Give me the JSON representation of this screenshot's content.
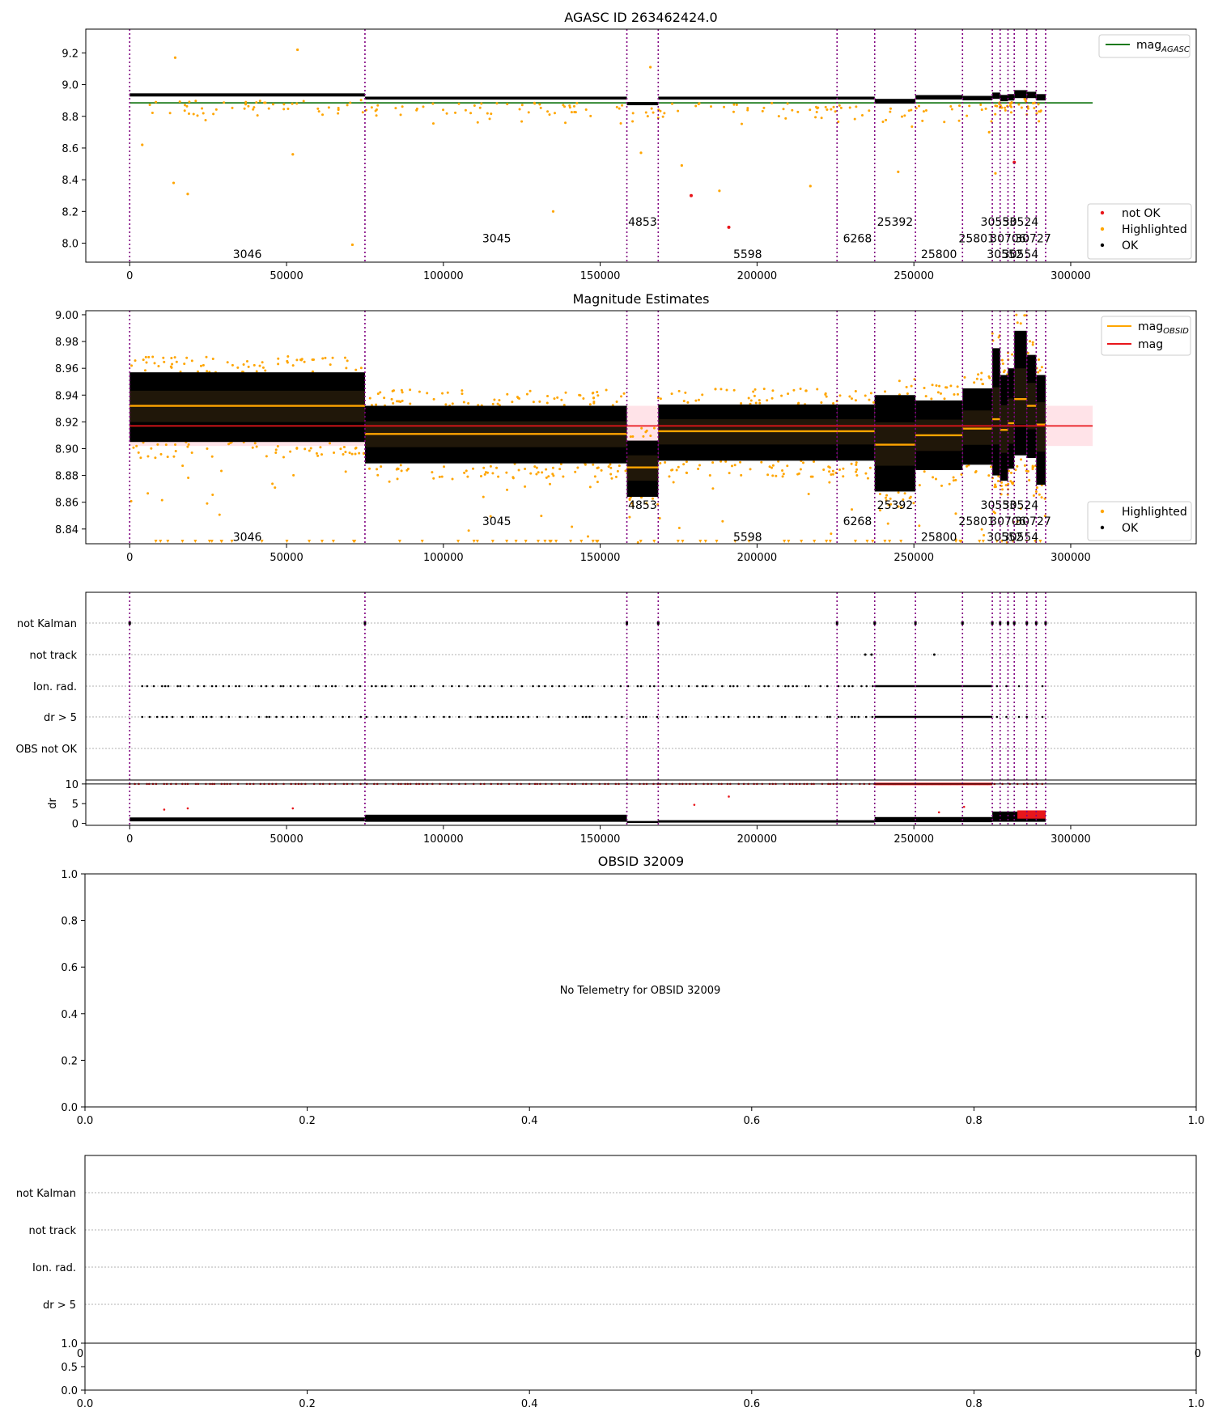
{
  "colors": {
    "agasc_line": "#1a7a1a",
    "mag_line": "#e8161b",
    "mag_band": "#ffc0cb",
    "obsid_line": "#ffa500",
    "highlighted": "#ffa500",
    "not_ok": "#e8161b",
    "ok": "#000000",
    "obs_boundary": "#800080"
  },
  "chart_data": [
    {
      "id": "agasc-panel",
      "type": "scatter",
      "title": "AGASC ID 263462424.0",
      "xlim": [
        -14000,
        340000
      ],
      "ylim": [
        7.88,
        9.35
      ],
      "xticks": [
        "0",
        "50000",
        "100000",
        "150000",
        "200000",
        "250000",
        "300000"
      ],
      "xtick_values": [
        0,
        50000,
        100000,
        150000,
        200000,
        250000,
        300000
      ],
      "yticks": [
        "8.0",
        "8.2",
        "8.4",
        "8.6",
        "8.8",
        "9.0",
        "9.2"
      ],
      "ytick_values": [
        8.0,
        8.2,
        8.4,
        8.6,
        8.8,
        9.0,
        9.2
      ],
      "legend_top": [
        {
          "label": "mag",
          "sub": "AGASC",
          "style": "line",
          "color": "#1a7a1a"
        }
      ],
      "legend_bottom": [
        {
          "label": "not OK",
          "style": "dot",
          "color": "#e8161b"
        },
        {
          "label": "Highlighted",
          "style": "dot",
          "color": "#ffa500"
        },
        {
          "label": "OK",
          "style": "dot",
          "color": "#000000"
        }
      ],
      "agasc_mag": 8.885,
      "agasc_x_range": [
        0,
        307000
      ],
      "segments": [
        {
          "obsid": "3046",
          "x0": 0,
          "x1": 75000,
          "mag": 8.935,
          "spread": 0.01
        },
        {
          "obsid": "3045",
          "x0": 75000,
          "x1": 158500,
          "mag": 8.915,
          "spread": 0.009
        },
        {
          "obsid": "4853",
          "x0": 158500,
          "x1": 168500,
          "mag": 8.88,
          "spread": 0.01
        },
        {
          "obsid": "5598",
          "x0": 168500,
          "x1": 225500,
          "mag": 8.915,
          "spread": 0.009
        },
        {
          "obsid": "6268",
          "x0": 225500,
          "x1": 237500,
          "mag": 8.915,
          "spread": 0.009
        },
        {
          "obsid": "25392",
          "x0": 237500,
          "x1": 250500,
          "mag": 8.895,
          "spread": 0.015
        },
        {
          "obsid": "25800",
          "x0": 250500,
          "x1": 265500,
          "mag": 8.92,
          "spread": 0.014
        },
        {
          "obsid": "25801",
          "x0": 265500,
          "x1": 275000,
          "mag": 8.915,
          "spread": 0.014
        },
        {
          "obsid": "30553",
          "x0": 275000,
          "x1": 277500,
          "mag": 8.93,
          "spread": 0.02
        },
        {
          "obsid": "30552",
          "x0": 277500,
          "x1": 280000,
          "mag": 8.915,
          "spread": 0.02
        },
        {
          "obsid": "30706",
          "x0": 280000,
          "x1": 282000,
          "mag": 8.92,
          "spread": 0.02
        },
        {
          "obsid": "30524",
          "x0": 282000,
          "x1": 286000,
          "mag": 8.94,
          "spread": 0.025
        },
        {
          "obsid": "30554",
          "x0": 286000,
          "x1": 289000,
          "mag": 8.935,
          "spread": 0.02
        },
        {
          "obsid": "30727",
          "x0": 289000,
          "x1": 292000,
          "mag": 8.92,
          "spread": 0.02
        }
      ],
      "obs_boundaries": [
        0,
        75000,
        158500,
        168500,
        225500,
        237500,
        250500,
        265500,
        275000,
        277500,
        280000,
        282000,
        286000,
        289000,
        292000
      ],
      "obsid_labels": [
        {
          "text": "3046",
          "x": 37500,
          "y": 7.93
        },
        {
          "text": "3045",
          "x": 117000,
          "y": 8.03
        },
        {
          "text": "4853",
          "x": 163500,
          "y": 8.135
        },
        {
          "text": "5598",
          "x": 197000,
          "y": 7.93
        },
        {
          "text": "6268",
          "x": 232000,
          "y": 8.03
        },
        {
          "text": "25392",
          "x": 244000,
          "y": 8.135
        },
        {
          "text": "25800",
          "x": 258000,
          "y": 7.93
        },
        {
          "text": "25801",
          "x": 270000,
          "y": 8.03
        },
        {
          "text": "30553",
          "x": 277000,
          "y": 8.135
        },
        {
          "text": "30706",
          "x": 280000,
          "y": 8.03
        },
        {
          "text": "30552",
          "x": 279000,
          "y": 7.93
        },
        {
          "text": "30524",
          "x": 284000,
          "y": 8.135
        },
        {
          "text": "30727",
          "x": 288000,
          "y": 8.03
        },
        {
          "text": "30554",
          "x": 284000,
          "y": 7.93
        }
      ],
      "not_ok_points": [
        {
          "x": 179000,
          "y": 8.3
        },
        {
          "x": 191000,
          "y": 8.1
        },
        {
          "x": 282000,
          "y": 8.51
        }
      ],
      "highlighted_outliers": [
        {
          "x": 14500,
          "y": 9.17
        },
        {
          "x": 53500,
          "y": 9.22
        },
        {
          "x": 166000,
          "y": 9.11
        },
        {
          "x": 4000,
          "y": 8.62
        },
        {
          "x": 14000,
          "y": 8.38
        },
        {
          "x": 18500,
          "y": 8.31
        },
        {
          "x": 52000,
          "y": 8.56
        },
        {
          "x": 71000,
          "y": 7.99
        },
        {
          "x": 135000,
          "y": 8.2
        },
        {
          "x": 188000,
          "y": 8.33
        },
        {
          "x": 217000,
          "y": 8.36
        },
        {
          "x": 245000,
          "y": 8.45
        },
        {
          "x": 276000,
          "y": 8.44
        },
        {
          "x": 274000,
          "y": 8.7
        },
        {
          "x": 163000,
          "y": 8.57
        },
        {
          "x": 176000,
          "y": 8.49
        }
      ]
    },
    {
      "id": "mag-estimates-panel",
      "type": "scatter",
      "title": "Magnitude Estimates",
      "xlim": [
        -14000,
        340000
      ],
      "ylim": [
        8.829,
        9.003
      ],
      "xticks": [
        "0",
        "50000",
        "100000",
        "150000",
        "200000",
        "250000",
        "300000"
      ],
      "xtick_values": [
        0,
        50000,
        100000,
        150000,
        200000,
        250000,
        300000
      ],
      "yticks": [
        "8.84",
        "8.86",
        "8.88",
        "8.90",
        "8.92",
        "8.94",
        "8.96",
        "8.98",
        "9.00"
      ],
      "ytick_values": [
        8.84,
        8.86,
        8.88,
        8.9,
        8.92,
        8.94,
        8.96,
        8.98,
        9.0
      ],
      "legend_top": [
        {
          "label": "mag",
          "sub": "OBSID",
          "style": "line",
          "color": "#ffa500"
        },
        {
          "label": "mag",
          "sub": "",
          "style": "line",
          "color": "#e8161b"
        }
      ],
      "legend_bottom": [
        {
          "label": "Highlighted",
          "style": "dot",
          "color": "#ffa500"
        },
        {
          "label": "OK",
          "style": "dot",
          "color": "#000000"
        }
      ],
      "mag": 8.917,
      "mag_band": [
        8.902,
        8.932
      ],
      "mag_x_range": [
        0,
        307000
      ],
      "obsid_mags": [
        {
          "x0": 0,
          "x1": 75000,
          "mag": 8.932,
          "lo": 8.905,
          "hi": 8.957
        },
        {
          "x0": 75000,
          "x1": 158500,
          "mag": 8.911,
          "lo": 8.889,
          "hi": 8.932
        },
        {
          "x0": 158500,
          "x1": 168500,
          "mag": 8.886,
          "lo": 8.864,
          "hi": 8.906
        },
        {
          "x0": 168500,
          "x1": 225500,
          "mag": 8.913,
          "lo": 8.891,
          "hi": 8.933
        },
        {
          "x0": 225500,
          "x1": 237500,
          "mag": 8.913,
          "lo": 8.891,
          "hi": 8.933
        },
        {
          "x0": 237500,
          "x1": 250500,
          "mag": 8.903,
          "lo": 8.868,
          "hi": 8.94
        },
        {
          "x0": 250500,
          "x1": 265500,
          "mag": 8.91,
          "lo": 8.884,
          "hi": 8.936
        },
        {
          "x0": 265500,
          "x1": 275000,
          "mag": 8.915,
          "lo": 8.888,
          "hi": 8.945
        },
        {
          "x0": 275000,
          "x1": 277500,
          "mag": 8.922,
          "lo": 8.88,
          "hi": 8.975
        },
        {
          "x0": 277500,
          "x1": 280000,
          "mag": 8.914,
          "lo": 8.876,
          "hi": 8.955
        },
        {
          "x0": 280000,
          "x1": 282000,
          "mag": 8.919,
          "lo": 8.885,
          "hi": 8.96
        },
        {
          "x0": 282000,
          "x1": 286000,
          "mag": 8.937,
          "lo": 8.895,
          "hi": 8.988
        },
        {
          "x0": 286000,
          "x1": 289000,
          "mag": 8.932,
          "lo": 8.893,
          "hi": 8.97
        },
        {
          "x0": 289000,
          "x1": 292000,
          "mag": 8.918,
          "lo": 8.873,
          "hi": 8.955
        }
      ],
      "obs_boundaries": [
        0,
        75000,
        158500,
        168500,
        225500,
        237500,
        250500,
        265500,
        275000,
        277500,
        280000,
        282000,
        286000,
        289000,
        292000
      ],
      "obsid_labels": [
        {
          "text": "3046",
          "x": 37500,
          "y": 8.834
        },
        {
          "text": "3045",
          "x": 117000,
          "y": 8.846
        },
        {
          "text": "4853",
          "x": 163500,
          "y": 8.858
        },
        {
          "text": "5598",
          "x": 197000,
          "y": 8.834
        },
        {
          "text": "6268",
          "x": 232000,
          "y": 8.846
        },
        {
          "text": "25392",
          "x": 244000,
          "y": 8.858
        },
        {
          "text": "25800",
          "x": 258000,
          "y": 8.834
        },
        {
          "text": "25801",
          "x": 270000,
          "y": 8.846
        },
        {
          "text": "30553",
          "x": 277000,
          "y": 8.858
        },
        {
          "text": "30706",
          "x": 280000,
          "y": 8.846
        },
        {
          "text": "30552",
          "x": 279000,
          "y": 8.834
        },
        {
          "text": "30524",
          "x": 284000,
          "y": 8.858
        },
        {
          "text": "30727",
          "x": 288000,
          "y": 8.846
        },
        {
          "text": "30554",
          "x": 284000,
          "y": 8.834
        }
      ]
    },
    {
      "id": "flags-panel",
      "type": "scatter",
      "categories": [
        "not Kalman",
        "not track",
        "Ion. rad.",
        "dr > 5",
        "OBS not OK"
      ],
      "xlim": [
        -14000,
        340000
      ],
      "xticks": [
        "0",
        "50000",
        "100000",
        "150000",
        "200000",
        "250000",
        "300000"
      ],
      "xtick_values": [
        0,
        50000,
        100000,
        150000,
        200000,
        250000,
        300000
      ],
      "obs_boundaries": [
        0,
        75000,
        158500,
        168500,
        225500,
        237500,
        250500,
        265500,
        275000,
        277500,
        280000,
        282000,
        286000,
        289000,
        292000
      ],
      "flag_points": {
        "not Kalman": [
          0,
          75000,
          158500,
          168500,
          225500,
          237500,
          250500,
          265500,
          275000,
          277500,
          280000,
          282000,
          286000,
          289000,
          292000
        ],
        "not track": [
          234500,
          236500,
          256500
        ],
        "ion_dense_range": [
          237500,
          275000
        ]
      },
      "dr_ylabel": "dr",
      "dr_yticks": [
        "0",
        "5",
        "10"
      ],
      "dr_ytick_values": [
        0,
        5,
        10
      ],
      "dr_ylim": [
        -0.5,
        11
      ]
    },
    {
      "id": "obsid-panel",
      "type": "scatter",
      "title": "OBSID 32009",
      "message": "No Telemetry for OBSID 32009",
      "xlim": [
        0,
        1
      ],
      "ylim": [
        0,
        1
      ],
      "xticks": [
        "0.0",
        "0.2",
        "0.4",
        "0.6",
        "0.8",
        "1.0"
      ],
      "yticks": [
        "0.0",
        "0.2",
        "0.4",
        "0.6",
        "0.8",
        "1.0"
      ]
    },
    {
      "id": "obsid-flags-panel",
      "type": "scatter",
      "categories": [
        "not Kalman",
        "not track",
        "Ion. rad.",
        "dr > 5"
      ],
      "sub_yticks": [
        "0.0",
        "0.5",
        "1.0"
      ],
      "xticks": [
        "0.0",
        "0.2",
        "0.4",
        "0.6",
        "0.8",
        "1.0"
      ],
      "clipped_left": "0",
      "clipped_right": "0"
    }
  ]
}
